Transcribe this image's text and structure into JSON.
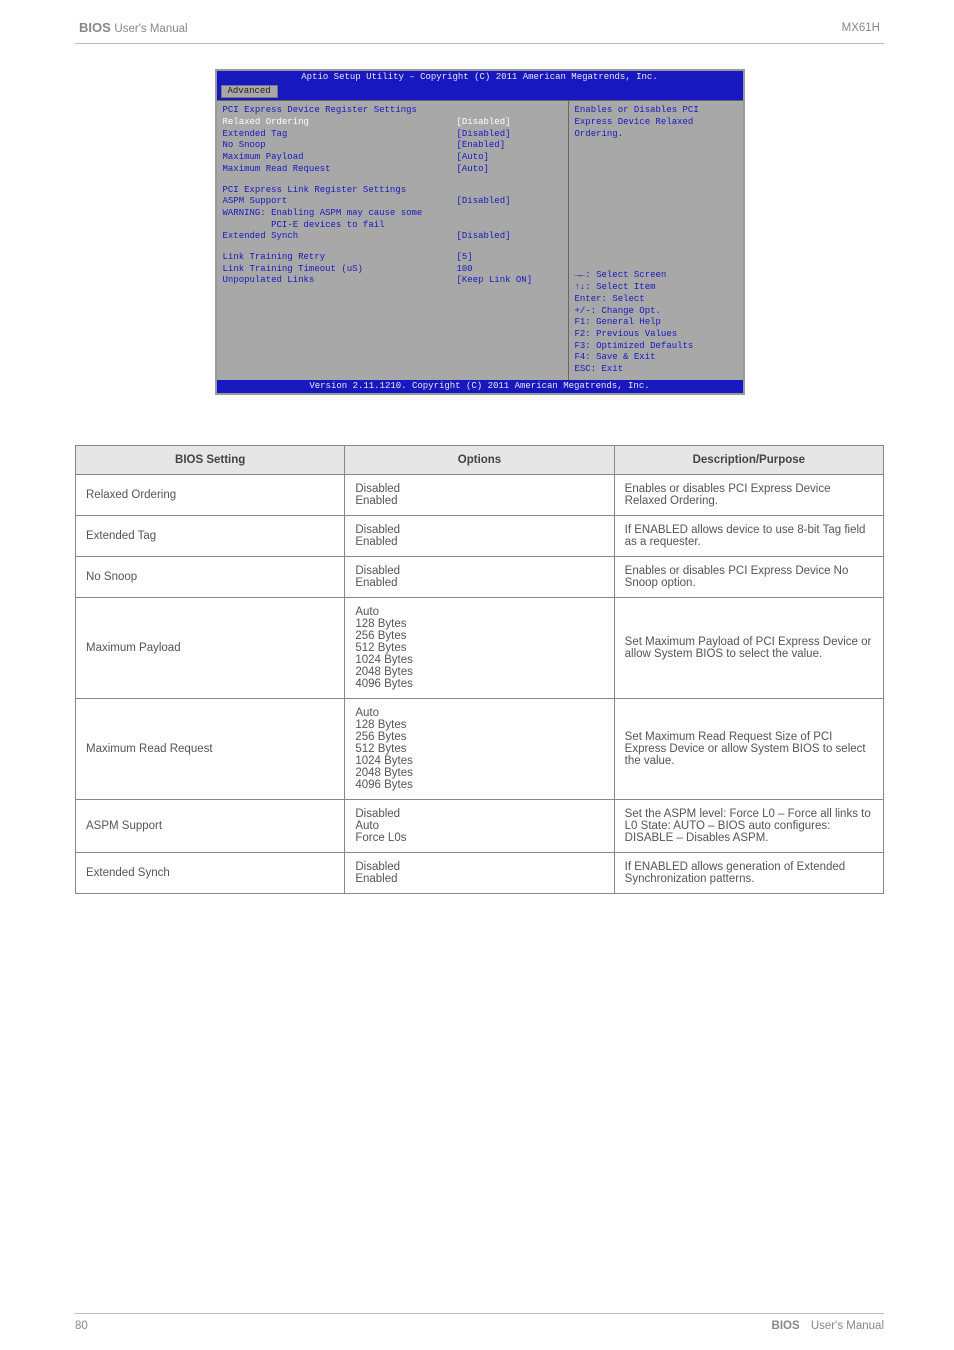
{
  "header": {
    "manual": "BIOS",
    "manual_suffix": "User's Manual",
    "product": "MX61H"
  },
  "bios": {
    "title": "Aptio Setup Utility – Copyright (C) 2011 American Megatrends, Inc.",
    "tab": "Advanced",
    "section1": "PCI Express Device Register Settings",
    "rows1": [
      {
        "label": "Relaxed Ordering",
        "value": "[Disabled]",
        "hl": true
      },
      {
        "label": "Extended Tag",
        "value": "[Disabled]"
      },
      {
        "label": "No Snoop",
        "value": "[Enabled]"
      },
      {
        "label": "Maximum Payload",
        "value": "[Auto]"
      },
      {
        "label": "Maximum Read Request",
        "value": "[Auto]"
      }
    ],
    "section2": "PCI Express Link Register Settings",
    "rows2": [
      {
        "label": "ASPM Support",
        "value": "[Disabled]"
      }
    ],
    "warning1": "WARNING: Enabling ASPM may cause some",
    "warning2": "         PCI-E devices to fail",
    "rows3": [
      {
        "label": "Extended Synch",
        "value": "[Disabled]"
      }
    ],
    "rows4": [
      {
        "label": "Link Training Retry",
        "value": "[5]"
      },
      {
        "label": "Link Training Timeout (uS)",
        "value": "100"
      },
      {
        "label": "Unpopulated Links",
        "value": "[Keep Link ON]"
      }
    ],
    "help": [
      "Enables or Disables PCI",
      "Express Device Relaxed",
      "Ordering."
    ],
    "hotkeys": [
      "→←: Select Screen",
      "↑↓: Select Item",
      "Enter: Select",
      "+/-: Change Opt.",
      "F1: General Help",
      "F2: Previous Values",
      "F3: Optimized Defaults",
      "F4: Save & Exit",
      "ESC: Exit"
    ],
    "footer": "Version 2.11.1210. Copyright (C) 2011 American Megatrends, Inc."
  },
  "table": {
    "headers": [
      "BIOS Setting",
      "Options",
      "Description/Purpose"
    ],
    "rows": [
      {
        "setting": "Relaxed Ordering",
        "options": [
          "Disabled",
          "Enabled"
        ],
        "desc": "Enables or disables PCI Express Device Relaxed Ordering."
      },
      {
        "setting": "Extended Tag",
        "options": [
          "Disabled",
          "Enabled"
        ],
        "desc": "If ENABLED allows device to use 8-bit Tag field as a requester."
      },
      {
        "setting": "No Snoop",
        "options": [
          "Disabled",
          "Enabled"
        ],
        "desc": "Enables or disables PCI Express Device No Snoop option."
      },
      {
        "setting": "Maximum Payload",
        "options": [
          "Auto",
          "128 Bytes",
          "256 Bytes",
          "512 Bytes",
          "1024 Bytes",
          "2048 Bytes",
          "4096 Bytes"
        ],
        "desc": "Set Maximum Payload of PCI Express Device or allow System BIOS to select the value."
      },
      {
        "setting": "Maximum Read Request",
        "options": [
          "Auto",
          "128 Bytes",
          "256 Bytes",
          "512 Bytes",
          "1024 Bytes",
          "2048 Bytes",
          "4096 Bytes"
        ],
        "desc": "Set Maximum Read Request Size of PCI Express Device or allow System BIOS to select the value."
      },
      {
        "setting": "ASPM Support",
        "options": [
          "Disabled",
          "Auto",
          "Force L0s"
        ],
        "desc": "Set the ASPM level: Force L0 – Force all links to L0 State: AUTO – BIOS auto configures: DISABLE – Disables ASPM."
      },
      {
        "setting": "Extended Synch",
        "options": [
          "Disabled",
          "Enabled"
        ],
        "desc": "If ENABLED allows generation of Extended Synchronization patterns."
      }
    ]
  },
  "footer": {
    "left": "80",
    "right_label": "BIOS",
    "right_suffix": "User's Manual"
  }
}
